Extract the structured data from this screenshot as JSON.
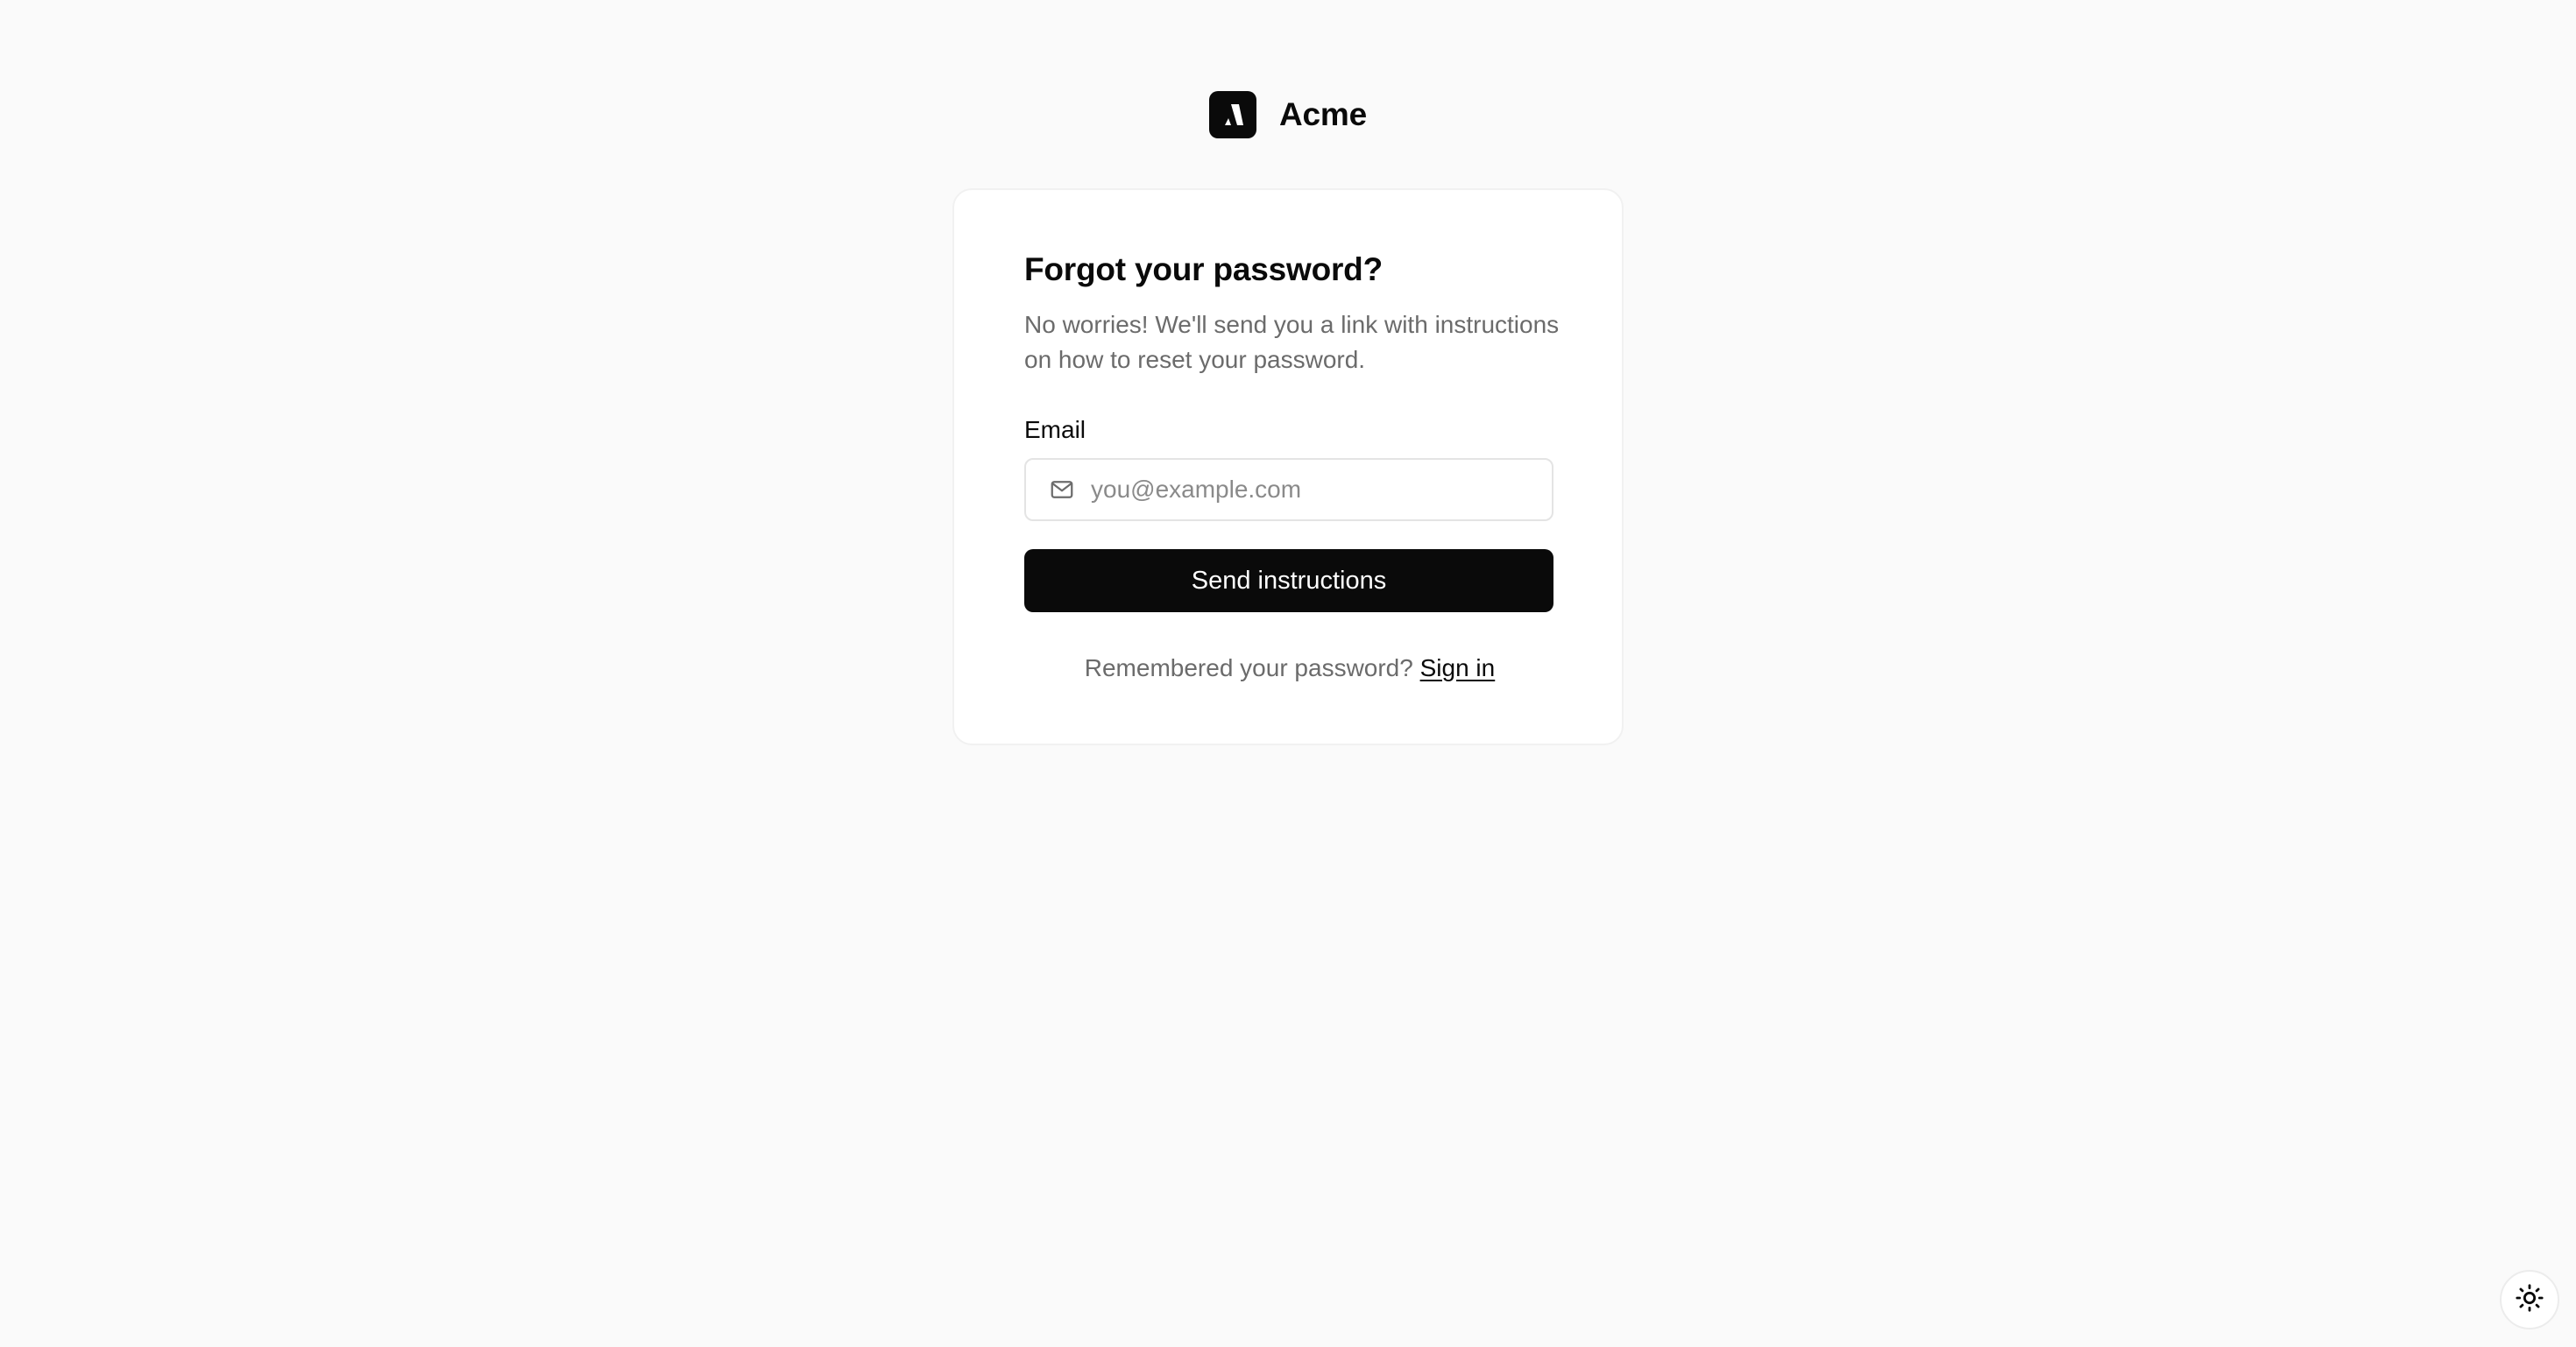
{
  "brand": {
    "name": "Acme",
    "logo_icon": "acme-logo-icon"
  },
  "card": {
    "title": "Forgot your password?",
    "subtitle": "No worries! We'll send you a link with instructions on how to reset your password.",
    "email_label": "Email",
    "email_placeholder": "you@example.com",
    "email_value": "",
    "email_icon": "mail-icon",
    "submit_label": "Send instructions",
    "footer_prompt": "Remembered your password?",
    "footer_link": "Sign in"
  },
  "theme_toggle": {
    "icon": "sun-icon"
  },
  "colors": {
    "background": "#fafafa",
    "card": "#ffffff",
    "primary": "#0a0a0a",
    "muted_text": "#6b6b6b"
  }
}
